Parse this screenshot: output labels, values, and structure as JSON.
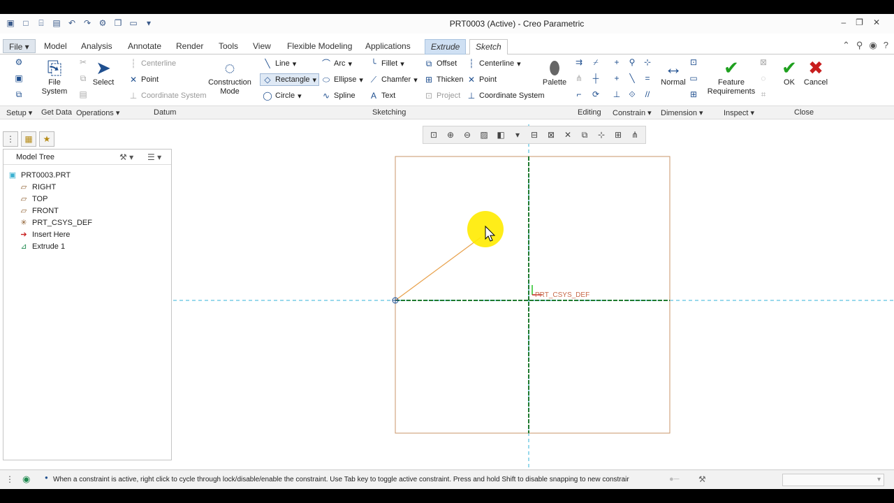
{
  "window": {
    "title": "PRT0003 (Active) - Creo Parametric",
    "controls": [
      "–",
      "❐",
      "✕"
    ]
  },
  "menubar": {
    "file": "File",
    "tabs": [
      "Model",
      "Analysis",
      "Annotate",
      "Render",
      "Tools",
      "View",
      "Flexible Modeling",
      "Applications"
    ],
    "extrude": "Extrude",
    "sketch": "Sketch"
  },
  "ribbon": {
    "file_system": "File\nSystem",
    "file_system_l1": "File",
    "file_system_l2": "System",
    "select": "Select",
    "datum": {
      "centerline": "Centerline",
      "point": "Point",
      "coordinate_system": "Coordinate System"
    },
    "construction_l1": "Construction",
    "construction_l2": "Mode",
    "sketching": {
      "line": "Line",
      "rectangle": "Rectangle",
      "circle": "Circle",
      "arc": "Arc",
      "ellipse": "Ellipse",
      "spline": "Spline",
      "fillet": "Fillet",
      "chamfer": "Chamfer",
      "text": "Text",
      "offset": "Offset",
      "thicken": "Thicken",
      "project": "Project",
      "centerline": "Centerline",
      "point": "Point",
      "coordinate_system": "Coordinate System"
    },
    "palette": "Palette",
    "normal": "Normal",
    "feature_req_l1": "Feature",
    "feature_req_l2": "Requirements",
    "ok": "OK",
    "cancel": "Cancel",
    "groups": {
      "setup": "Setup",
      "get_data": "Get Data",
      "operations": "Operations",
      "datum": "Datum",
      "sketching": "Sketching",
      "editing": "Editing",
      "constrain": "Constrain",
      "dimension": "Dimension",
      "inspect": "Inspect",
      "close": "Close"
    }
  },
  "model_tree": {
    "title": "Model Tree",
    "items": [
      {
        "label": "PRT0003.PRT",
        "icon": "part-icon"
      },
      {
        "label": "RIGHT",
        "icon": "datum-plane-icon"
      },
      {
        "label": "TOP",
        "icon": "datum-plane-icon"
      },
      {
        "label": "FRONT",
        "icon": "datum-plane-icon"
      },
      {
        "label": "PRT_CSYS_DEF",
        "icon": "csys-icon"
      },
      {
        "label": "Insert Here",
        "icon": "insert-arrow-icon"
      },
      {
        "label": "Extrude 1",
        "icon": "extrude-icon"
      }
    ]
  },
  "graphics": {
    "csys_label": "PRT_CSYS_DEF"
  },
  "status": {
    "message": "When a constraint is active, right click to cycle through lock/disable/enable the constraint. Use Tab key to toggle active constraint. Press and hold Shift to disable snapping to new constrair"
  },
  "colors": {
    "accent": "#1f4f8f",
    "sketch_line": "#c8956a",
    "centerline": "#33b3d9",
    "ok": "#1ea01e",
    "cancel": "#c81e1e",
    "highlight": "#ffeb00"
  }
}
